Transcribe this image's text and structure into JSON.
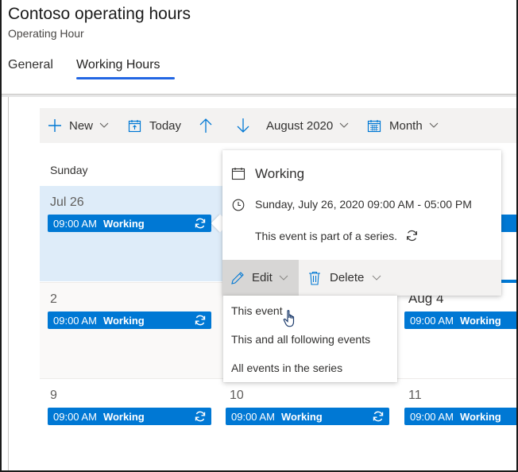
{
  "header": {
    "title": "Contoso operating hours",
    "subtitle": "Operating Hour",
    "tabs": [
      {
        "label": "General",
        "active": false
      },
      {
        "label": "Working Hours",
        "active": true
      }
    ],
    "accent_color": "#2266e3"
  },
  "toolbar": {
    "new_label": "New",
    "today_label": "Today",
    "up_icon": "arrow-up-icon",
    "down_icon": "arrow-down-icon",
    "period_label": "August 2020",
    "view_label": "Month"
  },
  "calendar": {
    "day_header": "Sunday",
    "event_color": "#0078d4",
    "cells": [
      {
        "date": "Jul 26",
        "selected": true,
        "event": {
          "time": "09:00 AM",
          "name": "Working",
          "recurring": true
        }
      },
      {
        "date": "2",
        "event": {
          "time": "09:00 AM",
          "name": "Working",
          "recurring": true
        }
      },
      {
        "date": "Aug 4",
        "event": {
          "time": "09:00 AM",
          "name": "Working",
          "recurring": false
        }
      },
      {
        "date": "9",
        "event": {
          "time": "09:00 AM",
          "name": "Working",
          "recurring": true
        }
      },
      {
        "date": "10",
        "event": {
          "time": "09:00 AM",
          "name": "Working",
          "recurring": true
        }
      },
      {
        "date": "11",
        "event": {
          "time": "09:00 AM",
          "name": "Working",
          "recurring": false
        }
      }
    ]
  },
  "callout": {
    "title": "Working",
    "time_range": "Sunday, July 26, 2020 09:00 AM - 05:00 PM",
    "series_note": "This event is part of a series.",
    "edit_label": "Edit",
    "delete_label": "Delete"
  },
  "edit_menu": {
    "items": [
      "This event",
      "This and all following events",
      "All events in the series"
    ]
  }
}
